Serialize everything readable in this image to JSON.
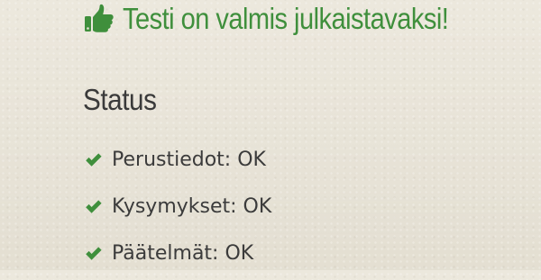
{
  "headline": {
    "text": "Testi on valmis julkaistavaksi!",
    "icon": "thumbs-up-icon",
    "color": "#3f8f3c"
  },
  "status": {
    "title": "Status",
    "items": [
      {
        "label": "Perustiedot: OK",
        "icon": "check-icon"
      },
      {
        "label": "Kysymykset: OK",
        "icon": "check-icon"
      },
      {
        "label": "Päätelmät: OK",
        "icon": "check-icon"
      }
    ],
    "check_color": "#3f8f3c"
  }
}
